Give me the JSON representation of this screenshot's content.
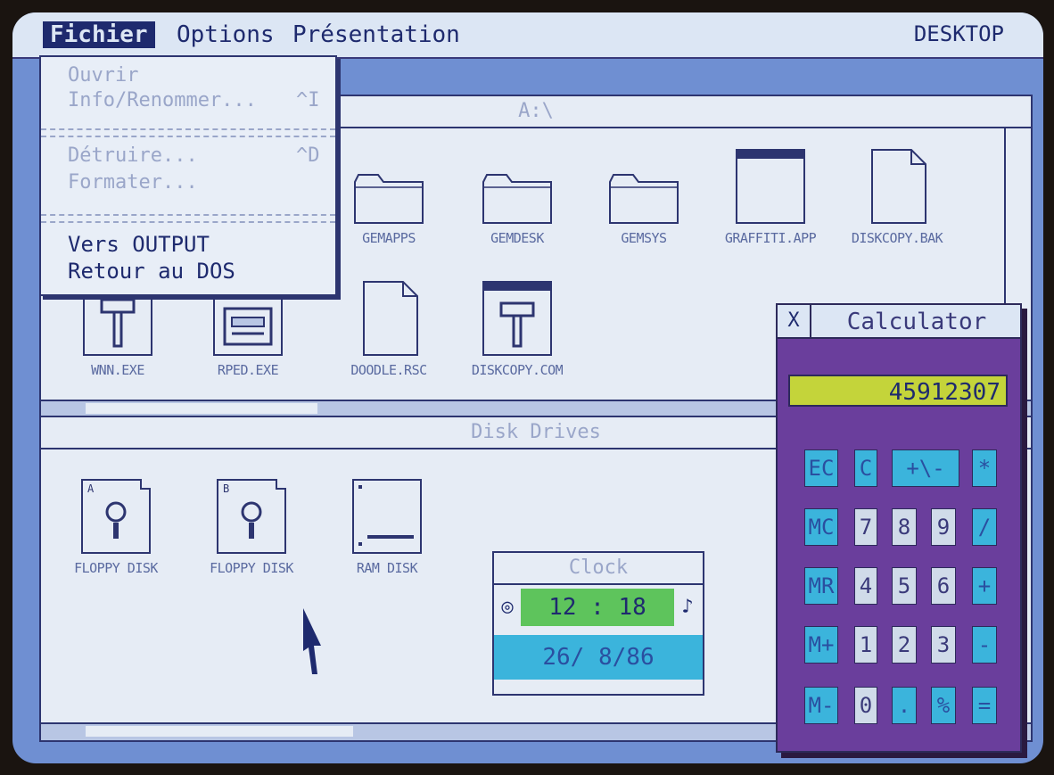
{
  "menubar": {
    "items": [
      "Fichier",
      "Options",
      "Présentation"
    ],
    "desktop_label": "DESKTOP"
  },
  "file_menu": {
    "open": "Ouvrir",
    "info": "Info/Renommer...",
    "info_shortcut": "^I",
    "delete": "Détruire...",
    "delete_shortcut": "^D",
    "format": "Formater...",
    "to_output": "Vers OUTPUT",
    "to_dos": "Retour au DOS"
  },
  "window_a": {
    "title": "A:\\",
    "icons": [
      "GEMAPPS",
      "GEMDESK",
      "GEMSYS",
      "GRAFFITI.APP",
      "DISKCOPY.BAK",
      "WNN.EXE",
      "RPED.EXE",
      "DOODLE.RSC",
      "DISKCOPY.COM"
    ]
  },
  "window_disks": {
    "title": "Disk Drives",
    "icons": [
      "FLOPPY DISK",
      "FLOPPY DISK",
      "RAM DISK"
    ],
    "drive_letters": [
      "A",
      "B"
    ]
  },
  "calculator": {
    "title": "Calculator",
    "close": "X",
    "display": "45912307",
    "keys": [
      [
        "EC",
        "C",
        "+\\-",
        "*"
      ],
      [
        "MC",
        "7",
        "8",
        "9",
        "/"
      ],
      [
        "MR",
        "4",
        "5",
        "6",
        "+"
      ],
      [
        "M+",
        "1",
        "2",
        "3",
        "-"
      ],
      [
        "M-",
        "0",
        ".",
        "%",
        "="
      ]
    ]
  },
  "clock": {
    "title": "Clock",
    "time": "12 : 18",
    "date": "26/ 8/86"
  },
  "colors": {
    "screen": "#6f8fd2",
    "window": "#e6ecf5",
    "calculator_body": "#6a3e9c",
    "key_cyan": "#3bb4dc",
    "display": "#c4d43a",
    "clock_time": "#5ec45c"
  }
}
